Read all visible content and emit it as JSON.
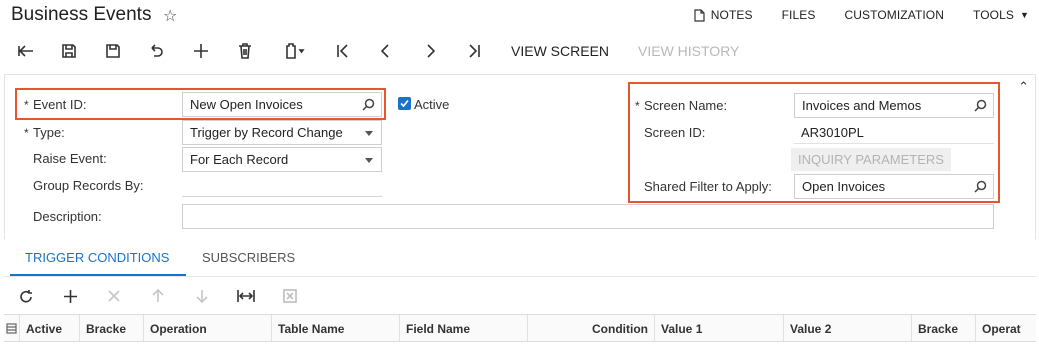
{
  "header": {
    "title": "Business Events",
    "links": {
      "notes": "NOTES",
      "files": "FILES",
      "customization": "CUSTOMIZATION",
      "tools": "TOOLS"
    }
  },
  "toolbar": {
    "view_screen": "VIEW SCREEN",
    "view_history": "VIEW HISTORY"
  },
  "form": {
    "event_id_label": "Event ID:",
    "event_id_value": "New Open Invoices",
    "active_label": "Active",
    "type_label": "Type:",
    "type_value": "Trigger by Record Change",
    "raise_event_label": "Raise Event:",
    "raise_event_value": "For Each Record",
    "group_records_label": "Group Records By:",
    "description_label": "Description:",
    "screen_name_label": "Screen Name:",
    "screen_name_value": "Invoices and Memos",
    "screen_id_label": "Screen ID:",
    "screen_id_value": "AR3010PL",
    "inquiry_parameters": "INQUIRY PARAMETERS",
    "shared_filter_label": "Shared Filter to Apply:",
    "shared_filter_value": "Open Invoices"
  },
  "tabs": {
    "trigger_conditions": "TRIGGER CONDITIONS",
    "subscribers": "SUBSCRIBERS"
  },
  "grid": {
    "columns": [
      "Active",
      "Bracke",
      "Operation",
      "Table Name",
      "Field Name",
      "Condition",
      "Value 1",
      "Value 2",
      "Bracke",
      "Operat"
    ]
  },
  "colors": {
    "accent": "#1a73c8",
    "highlight": "#e4572e"
  }
}
